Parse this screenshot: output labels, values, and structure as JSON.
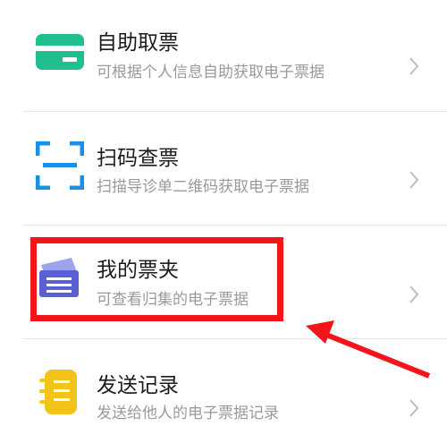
{
  "items": [
    {
      "title": "自助取票",
      "subtitle": "可根据个人信息自助获取电子票据",
      "icon": "card-icon",
      "color": "#1fbf8f"
    },
    {
      "title": "扫码查票",
      "subtitle": "扫描导诊单二维码获取电子票据",
      "icon": "scan-icon",
      "color": "#1a8fe8"
    },
    {
      "title": "我的票夹",
      "subtitle": "可查看归集的电子票据",
      "icon": "ticket-folder-icon",
      "color": "#5a5fd6"
    },
    {
      "title": "发送记录",
      "subtitle": "发送给他人的电子票据记录",
      "icon": "record-icon",
      "color": "#f3c318"
    }
  ],
  "annotation": {
    "highlight_color": "#f4141b"
  }
}
